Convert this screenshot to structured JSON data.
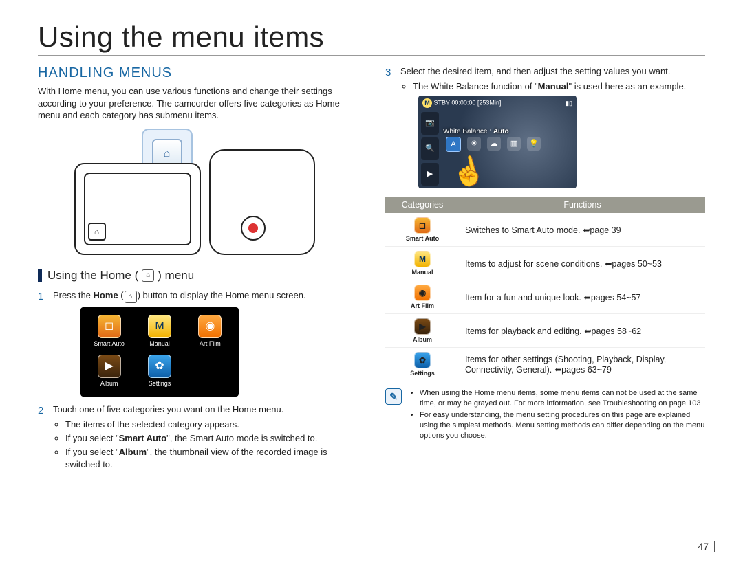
{
  "chapter_title": "Using the menu items",
  "section_title": "HANDLING MENUS",
  "intro": "With Home menu, you can use various functions and change their settings according to your preference. The camcorder offers five categories as Home menu and each category has submenu items.",
  "subhead_prefix": "Using the Home (",
  "subhead_suffix": ") menu",
  "home_glyph": "⌂",
  "steps": {
    "s1_num": "1",
    "s1_a": "Press the ",
    "s1_b": "Home",
    "s1_c": " (",
    "s1_d": ") button to display the Home menu screen.",
    "s2_num": "2",
    "s2": "Touch one of five categories you want on the Home menu.",
    "s2_b1": "The items of the selected category appears.",
    "s2_b2a": "If you select \"",
    "s2_b2b": "Smart Auto",
    "s2_b2c": "\", the Smart Auto mode is switched to.",
    "s2_b3a": "If you select \"",
    "s2_b3b": "Album",
    "s2_b3c": "\", the thumbnail view of the recorded image is switched to.",
    "s3_num": "3",
    "s3": "Select the desired item, and then adjust the setting values you want.",
    "s3_b1a": "The White Balance function of \"",
    "s3_b1b": "Manual",
    "s3_b1c": "\" is used here as an example."
  },
  "home_items": {
    "smart": "Smart Auto",
    "manual": "Manual",
    "art": "Art Film",
    "album": "Album",
    "settings": "Settings"
  },
  "wb": {
    "status": "STBY 00:00:00 [253Min]",
    "label_prefix": "White Balance : ",
    "label_value": "Auto"
  },
  "table": {
    "h1": "Categories",
    "h2": "Functions",
    "rows": [
      {
        "key": "smart",
        "label": "Smart Auto",
        "desc_a": "Switches to Smart Auto mode. ",
        "desc_b": "page 39"
      },
      {
        "key": "manual",
        "label": "Manual",
        "desc_a": "Items to adjust for scene conditions. ",
        "desc_b": "pages 50~53"
      },
      {
        "key": "art",
        "label": "Art Film",
        "desc_a": "Item for a fun and unique look. ",
        "desc_b": "pages 54~57"
      },
      {
        "key": "album",
        "label": "Album",
        "desc_a": "Items for playback and editing. ",
        "desc_b": "pages 58~62"
      },
      {
        "key": "settings",
        "label": "Settings",
        "desc_a": "Items for other settings (Shooting, Playback, Display, Connectivity, General). ",
        "desc_b": "pages 63~79"
      }
    ]
  },
  "notes": {
    "n1": "When using the Home menu items, some menu items can not be used at the same time, or may be grayed out. For more information, see Troubleshooting on page 103",
    "n2": "For easy understanding, the menu setting procedures on this page are explained using the simplest methods. Menu setting methods can differ depending on the menu options you choose."
  },
  "page_number": "47",
  "arrow_glyph": "➥",
  "icons": {
    "smart": "◻︎",
    "manual": "M",
    "art": "◉",
    "album": "▶",
    "settings": "✿",
    "camera": "📷",
    "zoom": "🔍",
    "play": "▶",
    "m_small": "M"
  }
}
